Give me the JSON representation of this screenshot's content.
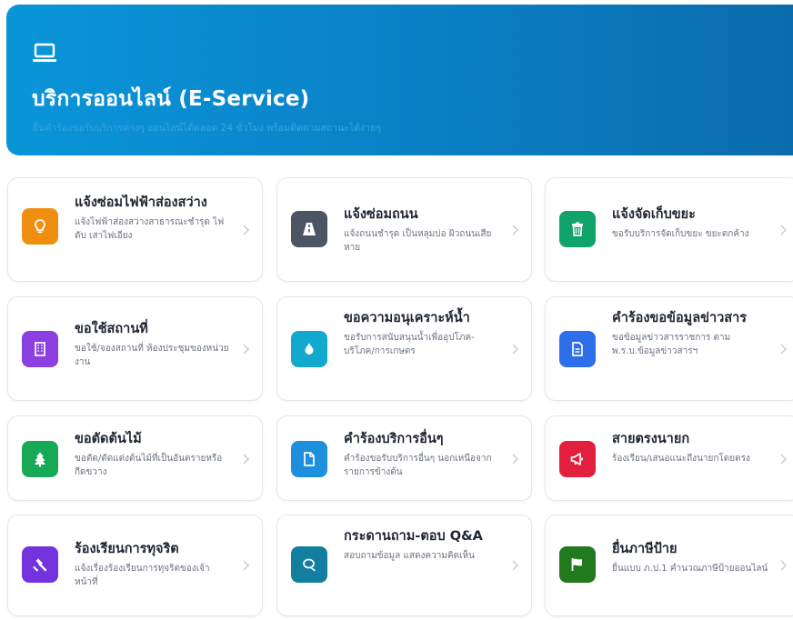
{
  "banner": {
    "icon": "laptop-icon",
    "title": "บริการออนไลน์ (E-Service)",
    "subtitle": "ยื่นคำร้องขอรับบริการต่างๆ ออนไลน์ได้ตลอด 24 ชั่วโมง พร้อมติดตามสถานะได้ง่ายๆ"
  },
  "services": [
    {
      "title": "แจ้งซ่อมไฟฟ้าส่องสว่าง",
      "desc": "แจ้งไฟฟ้าส่องสว่างสาธารณะชำรุด ไฟดับ เสาไฟเอียง",
      "icon": "lightbulb-icon",
      "color": "#ef8f0f"
    },
    {
      "title": "แจ้งซ่อมถนน",
      "desc": "แจ้งถนนชำรุด เป็นหลุมบ่อ ผิวถนนเสียหาย",
      "icon": "road-icon",
      "color": "#4b5563"
    },
    {
      "title": "แจ้งจัดเก็บขยะ",
      "desc": "ขอรับบริการจัดเก็บขยะ ขยะตกค้าง",
      "icon": "trash-icon",
      "color": "#10a36a"
    },
    {
      "title": "ขอใช้สถานที่",
      "desc": "ขอใช้/จองสถานที่ ห้องประชุมของหน่วยงาน",
      "icon": "building-icon",
      "color": "#8b3fe0"
    },
    {
      "title": "ขอความอนุเคราะห์น้ำ",
      "desc": "ขอรับการสนับสนุนน้ำเพื่ออุปโภค-บริโภค/การเกษตร",
      "icon": "water-drop-icon",
      "color": "#12a9cf"
    },
    {
      "title": "คำร้องขอข้อมูลข่าวสาร",
      "desc": "ขอข้อมูลข่าวสารราชการ ตาม พ.ร.บ.ข้อมูลข่าวสารฯ",
      "icon": "document-icon",
      "color": "#2d6fe8"
    },
    {
      "title": "ขอตัดต้นไม้",
      "desc": "ขอตัด/ตัดแต่งต้นไม้ที่เป็นอันตรายหรือกีดขวาง",
      "icon": "tree-icon",
      "color": "#18a957"
    },
    {
      "title": "คำร้องบริการอื่นๆ",
      "desc": "คำร้องขอรับบริการอื่นๆ นอกเหนือจากรายการข้างต้น",
      "icon": "file-icon",
      "color": "#1e8fdc"
    },
    {
      "title": "สายตรงนายก",
      "desc": "ร้องเรียน/เสนอแนะถึงนายกโดยตรง",
      "icon": "megaphone-icon",
      "color": "#e21f3c"
    },
    {
      "title": "ร้องเรียนการทุจริต",
      "desc": "แจ้งเรื่องร้องเรียนการทุจริตของเจ้าหน้าที่",
      "icon": "gavel-icon",
      "color": "#7432de"
    },
    {
      "title": "กระดานถาม-ตอบ Q&A",
      "desc": "สอบถามข้อมูล แสดงความคิดเห็น",
      "icon": "chat-icon",
      "color": "#127fa0"
    },
    {
      "title": "ยื่นภาษีป้าย",
      "desc": "ยื่นแบบ ภ.ป.1 คำนวณภาษีป้ายออนไลน์",
      "icon": "flag-icon",
      "color": "#227a1f"
    }
  ]
}
